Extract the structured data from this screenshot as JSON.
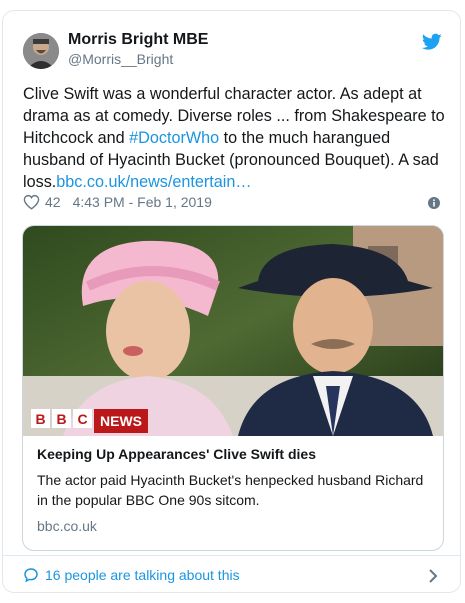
{
  "author": {
    "name": "Morris Bright MBE",
    "handle": "@Morris__Bright"
  },
  "tweet": {
    "text_before_hashtag": "Clive Swift was a wonderful character actor. As adept at drama as at comedy. Diverse roles ... from Shakespeare to Hitchcock and ",
    "hashtag": "#DoctorWho",
    "text_after_hashtag": " to the much harangued husband of Hyacinth Bucket (pronounced Bouquet). A sad loss.",
    "link": "bbc.co.uk/news/entertain…"
  },
  "meta": {
    "likes": "42",
    "timestamp": "4:43 PM - Feb 1, 2019"
  },
  "card": {
    "logo_letters": [
      "B",
      "B",
      "C"
    ],
    "logo_news": "NEWS",
    "title": "Keeping Up Appearances' Clive Swift dies",
    "description": "The actor paid Hyacinth Bucket's henpecked husband Richard in the popular BBC One 90s sitcom.",
    "domain": "bbc.co.uk"
  },
  "footer": {
    "talking": "16 people are talking about this"
  },
  "icons": {
    "brand": "twitter-bird-icon",
    "like": "heart-icon",
    "info": "info-icon",
    "reply": "speech-bubble-icon",
    "more": "chevron-right-icon"
  },
  "colors": {
    "link": "#1b95e0",
    "secondary_text": "#657786",
    "bbc_red": "#bb1919",
    "border": "#e1e8ed"
  }
}
